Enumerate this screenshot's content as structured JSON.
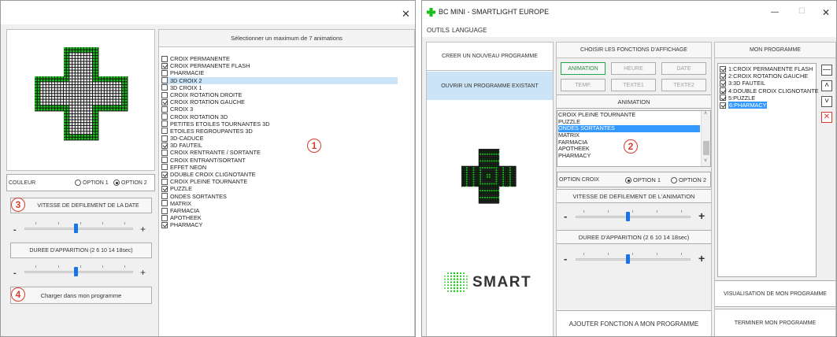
{
  "left_window": {
    "close_glyph": "✕",
    "animations_header": "Sélectionner un maximum de 7 animations",
    "animations": [
      {
        "label": "CROIX PERMANENTE",
        "checked": false
      },
      {
        "label": "CROIX PERMANENTE FLASH",
        "checked": true
      },
      {
        "label": "PHARMACIE",
        "checked": false
      },
      {
        "label": "3D CROIX 2",
        "checked": false,
        "highlighted": true
      },
      {
        "label": "3D CROIX 1",
        "checked": false
      },
      {
        "label": "CROIX ROTATION DROITE",
        "checked": false
      },
      {
        "label": "CROIX ROTATION GAUCHE",
        "checked": true
      },
      {
        "label": "CROIX 3",
        "checked": false
      },
      {
        "label": "CROIX ROTATION 3D",
        "checked": false
      },
      {
        "label": "PETITES ETOILES TOURNANTES 3D",
        "checked": false
      },
      {
        "label": "ETOILES REGROUPANTES 3D",
        "checked": false
      },
      {
        "label": "3D-CADUCE",
        "checked": false
      },
      {
        "label": "3D FAUTEIL",
        "checked": true
      },
      {
        "label": "CROIX RENTRANTE / SORTANTE",
        "checked": false
      },
      {
        "label": "CROIX ENTRANT/SORTANT",
        "checked": false
      },
      {
        "label": "EFFET NEON",
        "checked": false
      },
      {
        "label": "DOUBLE CROIX CLIGNOTANTE",
        "checked": true
      },
      {
        "label": "CROIX PLEINE TOURNANTE",
        "checked": false
      },
      {
        "label": "PUZZLE",
        "checked": true
      },
      {
        "label": "ONDES SORTANTES",
        "checked": false
      },
      {
        "label": "MATRIX",
        "checked": false
      },
      {
        "label": "FARMACIA",
        "checked": false
      },
      {
        "label": "APOTHEEK",
        "checked": false
      },
      {
        "label": "PHARMACY",
        "checked": true
      }
    ],
    "couleur_label": "COULEUR",
    "option1_label": "OPTION 1",
    "option2_label": "OPTION 2",
    "option_selected": 2,
    "speed_label": "VITESSE DE DEFILEMENT DE LA DATE",
    "duration_label": "DUREE D'APPARITION (2 6 10 14 18sec)",
    "minus_glyph": "-",
    "plus_glyph": "+",
    "speed_value": 0.47,
    "duration_value": 0.47,
    "load_button": "Charger dans mon programme"
  },
  "callouts": [
    "1",
    "2",
    "3",
    "4"
  ],
  "right_window": {
    "title": "BC MINI - SMARTLIGHT EUROPE",
    "menu": [
      "OUTILS",
      "LANGUAGE"
    ],
    "minimize_glyph": "—",
    "maximize_glyph": "☐",
    "close_glyph": "✕",
    "create_button": "CREER UN NOUVEAU PROGRAMME",
    "open_button": "OUVRIR UN PROGRAMME EXISTANT",
    "logo_text": "SMART",
    "functions_header": "CHOISIR LES FONCTIONS D'AFFICHAGE",
    "func_animation": "ANIMATION",
    "func_heure": "HEURE",
    "func_date": "DATE",
    "func_temp": "TEMP.",
    "func_texte1": "TEXTE1",
    "func_texte2": "TEXTE2",
    "animation_header": "ANIMATION",
    "animation_list": [
      {
        "label": "CROIX PLEINE TOURNANTE",
        "selected": false
      },
      {
        "label": "PUZZLE",
        "selected": false
      },
      {
        "label": "ONDES SORTANTES",
        "selected": true
      },
      {
        "label": "MATRIX",
        "selected": false
      },
      {
        "label": "FARMACIA",
        "selected": false
      },
      {
        "label": "APOTHEEK",
        "selected": false
      },
      {
        "label": "PHARMACY",
        "selected": false
      }
    ],
    "option_croix_label": "OPTION CROIX",
    "option1_label": "OPTION 1",
    "option2_label": "OPTION 2",
    "option_selected": 1,
    "speed_label": "VITESSE DE DEFILEMENT DE L'ANIMATION",
    "duration_label": "DUREE D'APPARITION (2 6 10 14 18sec)",
    "minus_glyph": "-",
    "plus_glyph": "+",
    "speed_value": 0.45,
    "duration_value": 0.45,
    "add_button": "AJOUTER FONCTION A MON PROGRAMME",
    "programme_header": "MON PROGRAMME",
    "programme_items": [
      {
        "label": "1:CROIX PERMANENTE FLASH",
        "checked": true,
        "selected": false
      },
      {
        "label": "2:CROIX ROTATION GAUCHE",
        "checked": true,
        "selected": false
      },
      {
        "label": "3:3D FAUTEIL",
        "checked": true,
        "selected": false
      },
      {
        "label": "4:DOUBLE CROIX CLIGNOTANTE",
        "checked": true,
        "selected": false
      },
      {
        "label": "5:PUZZLE",
        "checked": true,
        "selected": false
      },
      {
        "label": "6:PHARMACY",
        "checked": true,
        "selected": true
      }
    ],
    "side_buttons": [
      {
        "glyph": "—",
        "name": "remove-item-button"
      },
      {
        "glyph": "˄",
        "name": "move-up-button"
      },
      {
        "glyph": "˅",
        "name": "move-down-button"
      },
      {
        "glyph": "✕",
        "name": "delete-item-button"
      }
    ],
    "visualisation_button": "VISUALISATION DE MON PROGRAMME",
    "terminer_button": "TERMINER MON PROGRAMME"
  },
  "colors": {
    "led_green": "#18c01a",
    "led_white": "#f4f4f4",
    "led_dark": "#0c3a0c",
    "accent_blue": "#3399ff",
    "callout_red": "#d73a2a",
    "slider_thumb": "#1a73e8"
  }
}
